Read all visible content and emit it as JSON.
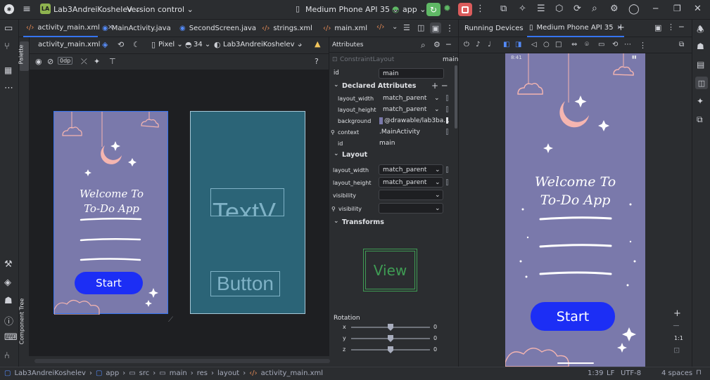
{
  "titlebar": {
    "project_badge": "LA",
    "project_name": "Lab3AndreiKoshelev",
    "vcs": "Version control",
    "device": "Medium Phone API 35",
    "run_config": "app"
  },
  "editor_tabs": [
    {
      "label": "activity_main.xml",
      "active": true,
      "closable": true
    },
    {
      "label": "MainActivity.java"
    },
    {
      "label": "SecondScreen.java"
    },
    {
      "label": "strings.xml"
    },
    {
      "label": "main.xml"
    }
  ],
  "design_toolbar": {
    "file": "activity_main.xml",
    "device": "Pixel",
    "api": "34",
    "theme": "Lab3AndreiKoshelev",
    "margin": "0dp"
  },
  "side_labels": {
    "palette": "Palette",
    "component_tree": "Component Tree"
  },
  "design_preview": {
    "welcome_line1": "Welcome To",
    "welcome_line2": "To-Do App",
    "start_button": "Start"
  },
  "blueprint_preview": {
    "textview": "TextV",
    "button": "Button"
  },
  "attributes": {
    "title": "Attributes",
    "component": "ConstraintLayout",
    "component_id": "main",
    "id_label": "id",
    "id_value": "main",
    "declared_title": "Declared Attributes",
    "declared": [
      {
        "name": "layout_width",
        "value": "match_parent"
      },
      {
        "name": "layout_height",
        "value": "match_parent"
      },
      {
        "name": "background",
        "value": "@drawable/lab3ba..."
      },
      {
        "name": "context",
        "value": ".MainActivity"
      },
      {
        "name": "id",
        "value": "main"
      }
    ],
    "layout_title": "Layout",
    "layout": [
      {
        "name": "layout_width",
        "value": "match_parent"
      },
      {
        "name": "layout_height",
        "value": "match_parent"
      },
      {
        "name": "visibility",
        "value": ""
      },
      {
        "name": "visibility",
        "value": ""
      }
    ],
    "transforms_title": "Transforms",
    "view_label": "View",
    "rotation_title": "Rotation",
    "rotation": [
      {
        "axis": "x",
        "value": "0",
        "fraction": 0.5
      },
      {
        "axis": "y",
        "value": "0",
        "fraction": 0.5
      },
      {
        "axis": "z",
        "value": "0",
        "fraction": 0.5
      }
    ]
  },
  "running_devices": {
    "title": "Running Devices",
    "device_tab": "Medium Phone API 35",
    "status_time": "8:41",
    "welcome_line1": "Welcome To",
    "welcome_line2": "To-Do App",
    "start_button": "Start",
    "zoom_ratio": "1:1"
  },
  "statusbar": {
    "breadcrumbs": [
      "Lab3AndreiKoshelev",
      "app",
      "src",
      "main",
      "res",
      "layout",
      "activity_main.xml"
    ],
    "position": "1:39",
    "line_sep": "LF",
    "encoding": "UTF-8",
    "indent": "4 spaces"
  },
  "colors": {
    "accent": "#3574f0",
    "phone_bg": "#7a79ab",
    "start_button": "#1c2ef5",
    "moon": "#f5b5b0",
    "blueprint": "#2b6477",
    "run_green": "#5fb865",
    "stop_red": "#db5c5c"
  }
}
